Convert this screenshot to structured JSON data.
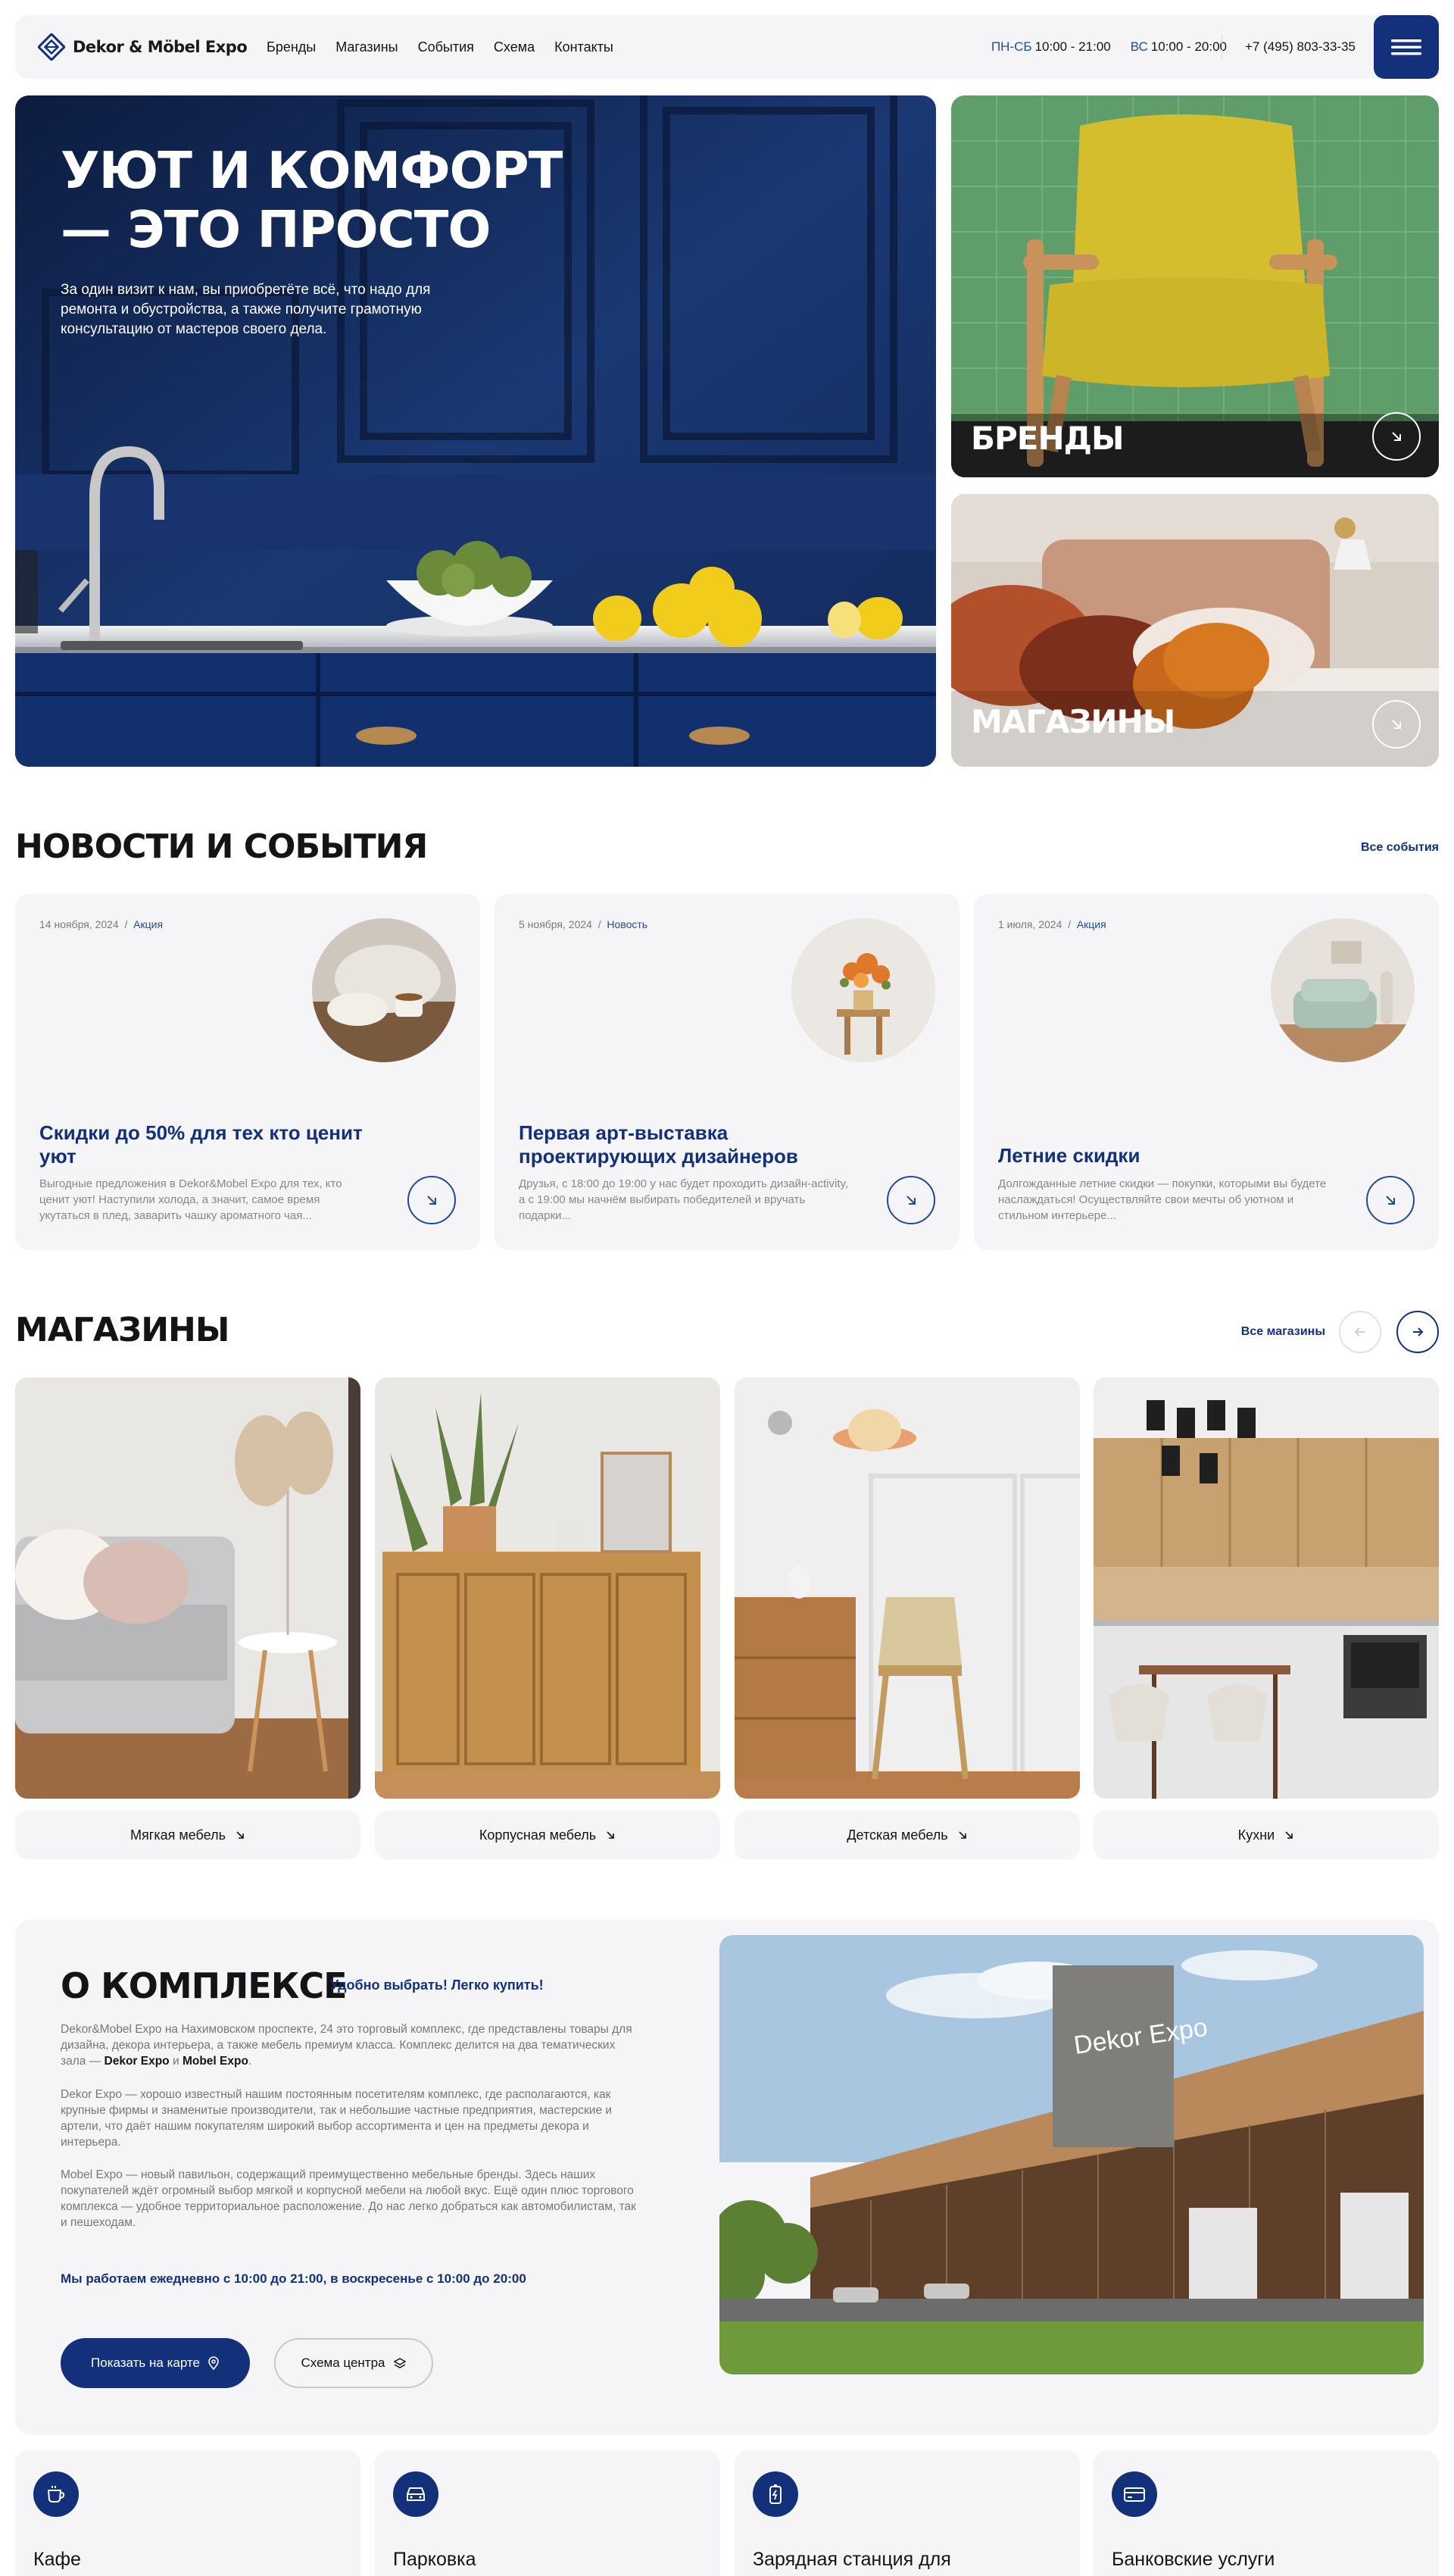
{
  "header": {
    "logo": "Dekor & Möbel Expo",
    "nav": [
      "Бренды",
      "Магазины",
      "События",
      "Схема",
      "Контакты"
    ],
    "hours": [
      {
        "label": "ПН-СБ",
        "value": "10:00 - 21:00"
      },
      {
        "label": "ВС",
        "value": "10:00 - 20:00"
      }
    ],
    "phone": "+7 (495) 803-33-35"
  },
  "hero": {
    "title_line1": "УЮТ И КОМФОРТ",
    "title_line2": "— ЭТО ПРОСТО",
    "subtitle": "За один визит к нам, вы приобретёте всё, что надо для ремонта и обустройства, а также получите грамотную консультацию от мастеров своего дела."
  },
  "tiles": {
    "brands": "БРЕНДЫ",
    "stores": "МАГАЗИНЫ"
  },
  "news": {
    "title": "НОВОСТИ И СОБЫТИЯ",
    "all_link": "Все события",
    "items": [
      {
        "date": "14 ноября, 2024",
        "tag": "Акция",
        "title": "Скидки до 50% для тех кто ценит уют",
        "text": "Выгодные предложения в Dekor&Mobel Expo для тех, кто ценит уют! Наступили холода, а значит, самое время укутаться в плед, заварить чашку ароматного чая..."
      },
      {
        "date": "5 ноября, 2024",
        "tag": "Новость",
        "title": "Первая арт-выставка проектирующих дизайнеров",
        "text": "Друзья, с 18:00 до 19:00 у нас будет проходить дизайн-activity, а с 19:00 мы начнём выбирать победителей и вручать подарки..."
      },
      {
        "date": "1 июля, 2024",
        "tag": "Акция",
        "title": "Летние скидки",
        "text": "Долгожданные летние скидки — покупки, которыми вы будете наслаждаться! Осуществляйте свои мечты об уютном и стильном интерьере..."
      }
    ]
  },
  "stores": {
    "title": "МАГАЗИНЫ",
    "all_link": "Все магазины",
    "items": [
      "Мягкая мебель",
      "Корпусная мебель",
      "Детская мебель",
      "Кухни"
    ]
  },
  "about": {
    "title": "О КОМПЛЕКСЕ",
    "slogan": "Удобно выбрать! Легко купить!",
    "p1_before": "Dekor&Mobel Expo на Нахимовском проспекте, 24 это торговый комплекс, где представлены товары для дизайна, декора интерьера, а также мебель премиум класса. Комплекс делится на два тематических зала — ",
    "p1_b1": "Dekor Expo",
    "p1_mid": " и ",
    "p1_b2": "Mobel Expo",
    "p1_end": ".",
    "p2": "Dekor Expo — хорошо известный нашим постоянным посетителям комплекс, где располагаются, как крупные фирмы и знаменитые производители, так и небольшие частные предприятия, мастерские и артели, что даёт нашим покупателям широкий выбор ассортимента и цен на предметы декора и интерьера.",
    "p3": "Mobel Expo — новый павильон, содержащий преимущественно мебельные бренды. Здесь наших покупателей ждёт огромный выбор мягкой и корпусной мебели на любой вкус. Ещё один плюс торгового комплекса — удобное территориальное расположение. До нас легко добраться как автомобилистам, так и пешеходам.",
    "hours": "Мы работаем ежедневно с 10:00 до 21:00, в воскресенье с 10:00 до 20:00",
    "btn_map": "Показать на карте",
    "btn_scheme": "Схема центра",
    "building_sign": "Dekor Expo"
  },
  "services": [
    "Кафе",
    "Парковка",
    "Зарядная станция для",
    "Банковские услуги"
  ],
  "colors": {
    "brand": "#13307a",
    "accent": "#1f4c91",
    "surface": "#f5f5f7"
  }
}
